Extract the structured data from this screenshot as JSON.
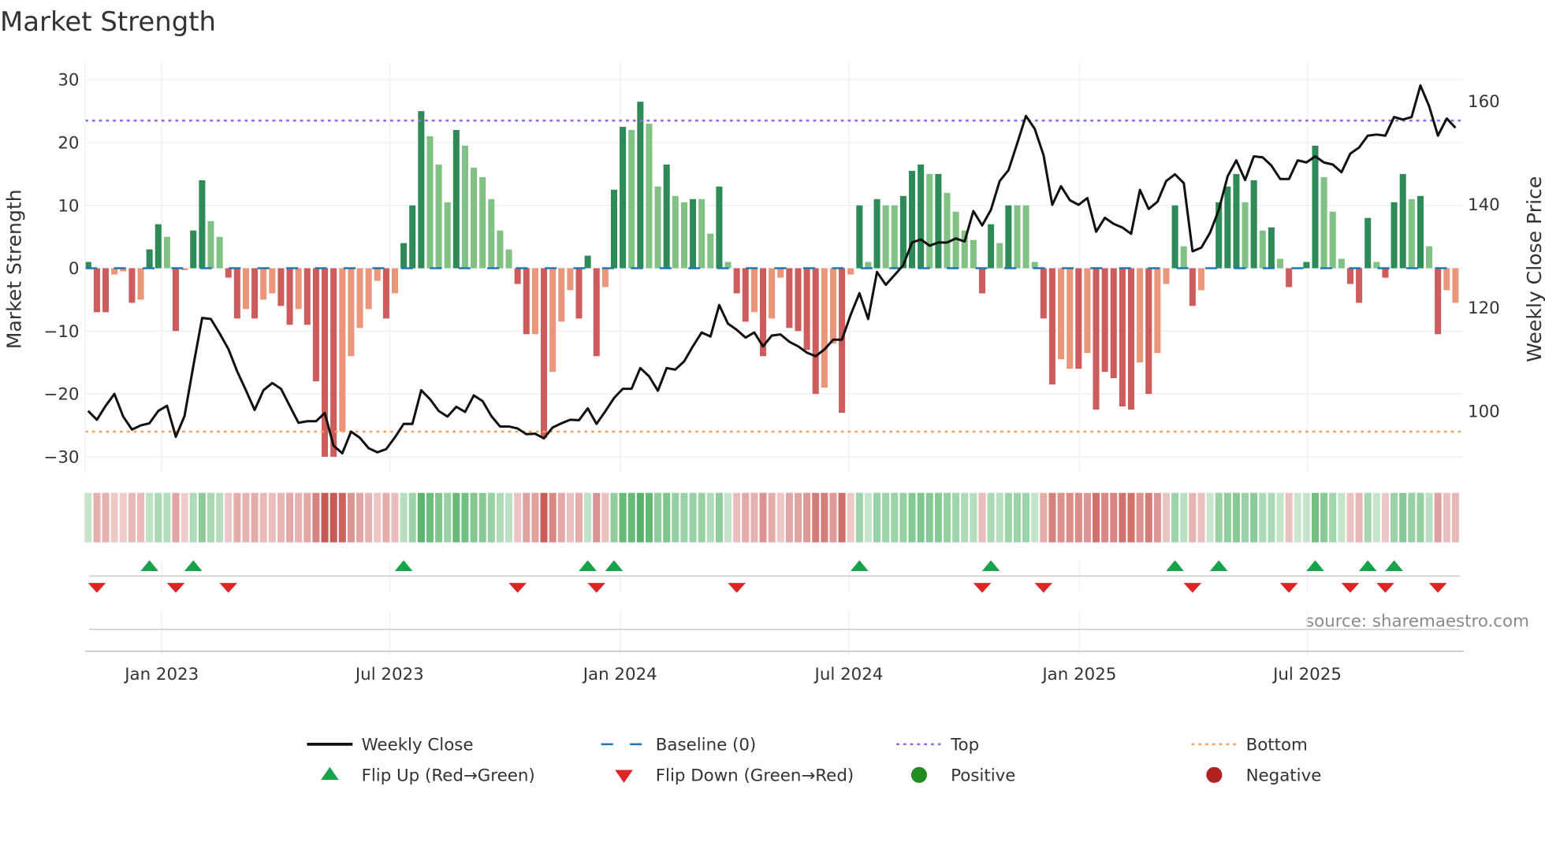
{
  "chart_data": {
    "type": "bar",
    "title": "Market Strength",
    "ylabel": "Market Strength",
    "y2label": "Weekly Close Price",
    "ylim": [
      -33,
      33
    ],
    "y2lim": [
      90,
      166
    ],
    "yticks": [
      30,
      20,
      10,
      0,
      -10,
      -20,
      -30
    ],
    "yticklabels": [
      "30",
      "20",
      "10",
      "0",
      "−10",
      "−20",
      "−30"
    ],
    "y2ticks": [
      160,
      140,
      120,
      100
    ],
    "top_level": 23.5,
    "bottom_level": -26,
    "baseline": 0,
    "xticks": [
      {
        "label": "Jan 2023",
        "week": 8.4
      },
      {
        "label": "Jul 2023",
        "week": 34.4
      },
      {
        "label": "Jan 2024",
        "week": 60.7
      },
      {
        "label": "Jul 2024",
        "week": 86.8
      },
      {
        "label": "Jan 2025",
        "week": 113.1
      },
      {
        "label": "Jul 2025",
        "week": 139.1
      }
    ],
    "strength": [
      1,
      -7,
      -7,
      -1,
      -0.5,
      -5.5,
      -5,
      3,
      7,
      5,
      -10,
      -0.3,
      6,
      14,
      7.5,
      5,
      -1.5,
      -8,
      -6.5,
      -8,
      -5,
      -4,
      -6,
      -9,
      -6.5,
      -9,
      -18,
      -30,
      -30,
      -26,
      -14,
      -9.5,
      -6.5,
      -2,
      -8,
      -4,
      4,
      10,
      25,
      21,
      16.5,
      10.5,
      22,
      19.5,
      16,
      14.5,
      11,
      6,
      3,
      -2.5,
      -10.5,
      -10.5,
      -27,
      -16.5,
      -8.5,
      -3.5,
      -8,
      2,
      -14,
      -3,
      12.5,
      22.5,
      22,
      26.5,
      23,
      13,
      16.5,
      11.5,
      10.5,
      11,
      11,
      5.5,
      13,
      1,
      -4,
      -8.5,
      -7,
      -14,
      -8,
      -1.5,
      -9.5,
      -10,
      -13,
      -20,
      -19,
      -12,
      -23,
      -1,
      10,
      1,
      11,
      10,
      10,
      11.5,
      15.5,
      16.5,
      15,
      15,
      12,
      9,
      6,
      4.5,
      -4,
      7,
      4,
      10,
      10,
      10,
      1,
      -8,
      -18.5,
      -14.5,
      -16,
      -16,
      -13.5,
      -22.5,
      -16.5,
      -17.5,
      -22,
      -22.5,
      -15,
      -20,
      -13.5,
      -2.5,
      10,
      3.5,
      -6,
      -3.5,
      0,
      10.5,
      13,
      15,
      10.5,
      14,
      6,
      6.5,
      1.5,
      -3,
      0,
      1,
      19.5,
      14.5,
      9,
      1.5,
      -2.5,
      -5.5,
      8,
      1,
      -1.5,
      10.5,
      15,
      11,
      11.5,
      3.5,
      -10.5,
      -3.5,
      -5.5
    ],
    "strong": [
      1,
      1,
      1,
      0,
      0,
      1,
      0,
      1,
      1,
      0,
      1,
      0,
      1,
      1,
      0,
      0,
      1,
      1,
      0,
      1,
      0,
      0,
      1,
      1,
      0,
      1,
      1,
      1,
      1,
      0,
      0,
      0,
      0,
      0,
      1,
      0,
      1,
      1,
      1,
      0,
      0,
      0,
      1,
      0,
      0,
      0,
      0,
      0,
      0,
      1,
      1,
      0,
      1,
      0,
      0,
      0,
      1,
      1,
      1,
      0,
      1,
      1,
      0,
      1,
      0,
      0,
      1,
      0,
      0,
      1,
      0,
      0,
      1,
      0,
      1,
      1,
      0,
      1,
      0,
      0,
      1,
      1,
      1,
      1,
      0,
      0,
      1,
      0,
      1,
      0,
      1,
      0,
      0,
      1,
      1,
      1,
      0,
      1,
      0,
      0,
      0,
      0,
      1,
      1,
      0,
      1,
      0,
      0,
      0,
      1,
      1,
      0,
      0,
      1,
      0,
      1,
      1,
      1,
      1,
      1,
      0,
      1,
      0,
      0,
      1,
      0,
      1,
      0,
      0,
      1,
      1,
      1,
      0,
      1,
      0,
      1,
      0,
      1,
      0,
      1,
      1,
      0,
      0,
      0,
      1,
      1,
      1,
      0,
      1,
      1,
      1,
      0,
      1,
      0,
      1,
      0,
      0
    ],
    "weekly_close": [
      100,
      98.3,
      101,
      103.3,
      98.9,
      96.4,
      97.2,
      97.6,
      100,
      101,
      95,
      99,
      108.7,
      118,
      117.8,
      115,
      112,
      107.7,
      104,
      100.2,
      104,
      105.4,
      104.3,
      101,
      97.7,
      98,
      98,
      99.6,
      93.3,
      91.8,
      96,
      94.8,
      92.8,
      92,
      92.6,
      94.9,
      97.5,
      97.5,
      104,
      102.3,
      100,
      98.9,
      100.8,
      99.8,
      103,
      101.9,
      99,
      97,
      97,
      96.6,
      95.5,
      95.6,
      94.7,
      96.8,
      97.6,
      98.3,
      98.2,
      100.5,
      97.5,
      99.9,
      102.5,
      104.3,
      104.3,
      108.3,
      106.7,
      103.9,
      108.3,
      108,
      109.6,
      112.5,
      115.2,
      114.4,
      120.5,
      116.9,
      115.7,
      114.2,
      115.2,
      112.5,
      114.6,
      114.8,
      113.4,
      112.5,
      111.3,
      110.6,
      111.9,
      113.8,
      113.8,
      118.6,
      122.8,
      117.8,
      126.9,
      124.4,
      126.3,
      128.2,
      132.6,
      133.2,
      132,
      132.6,
      132.6,
      133.4,
      132.8,
      138.7,
      135.9,
      138.9,
      144.5,
      146.6,
      151.8,
      157.1,
      154.6,
      149.5,
      139.9,
      143.5,
      140.8,
      139.9,
      141.2,
      134.7,
      137.4,
      136.2,
      135.5,
      134.3,
      142.8,
      139.1,
      140.5,
      144.5,
      145.8,
      144.1,
      130.9,
      131.6,
      134.5,
      138.9,
      145.4,
      148.5,
      144.7,
      149.3,
      149.1,
      147.5,
      144.9,
      144.9,
      148.5,
      148.1,
      149.3,
      148.1,
      147.7,
      146.2,
      149.8,
      151,
      153.3,
      153.5,
      153.3,
      156.9,
      156.4,
      156.9,
      163,
      159,
      153.3,
      156.6,
      154.8
    ],
    "flip_up_weeks": [
      7,
      12,
      36,
      57,
      60,
      88,
      103,
      124,
      129,
      140,
      146,
      149
    ],
    "flip_down_weeks": [
      1,
      10,
      16,
      49,
      58,
      74,
      102,
      109,
      126,
      137,
      144,
      148,
      154
    ],
    "legend": {
      "placement": "bottom",
      "items": [
        {
          "key": "weekly_close",
          "label": "Weekly Close"
        },
        {
          "key": "baseline",
          "label": "Baseline (0)"
        },
        {
          "key": "top",
          "label": "Top"
        },
        {
          "key": "bottom",
          "label": "Bottom"
        },
        {
          "key": "flip_up",
          "label": "Flip Up (Red→Green)"
        },
        {
          "key": "flip_down",
          "label": "Flip Down (Green→Red)"
        },
        {
          "key": "positive",
          "label": "Positive"
        },
        {
          "key": "negative",
          "label": "Negative"
        }
      ]
    },
    "annotation": "source: sharemaestro.com",
    "colors": {
      "pos_strong": "#2e8b57",
      "pos_weak": "#82c184",
      "neg_strong": "#cd5c5c",
      "neg_weak": "#e9967a",
      "line": "#111111",
      "baseline": "#1f77b4",
      "top": "#9467dd",
      "bottom": "#f4a261",
      "flip_up": "#17a34a",
      "flip_down": "#dc2626",
      "positive": "#228b22",
      "negative": "#b22222"
    }
  }
}
